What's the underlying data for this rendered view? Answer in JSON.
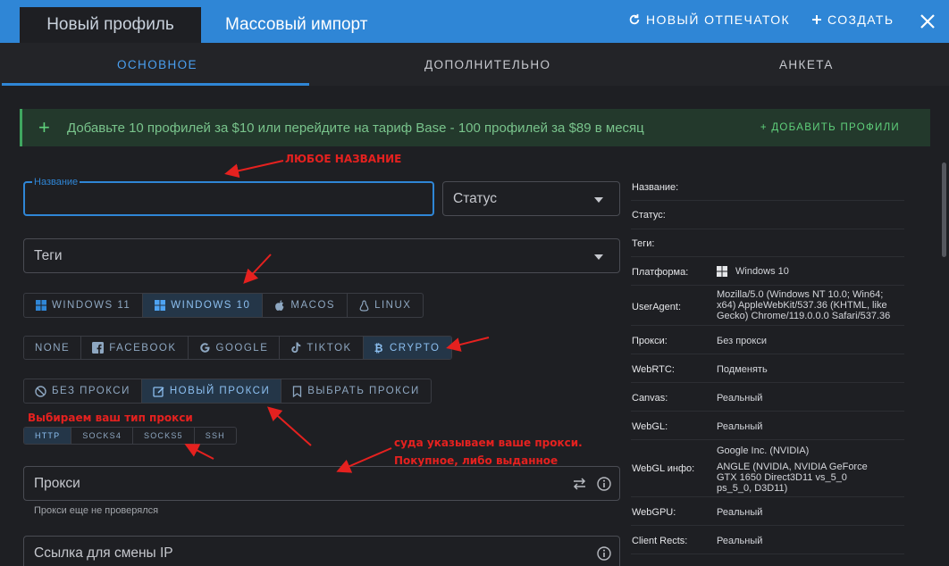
{
  "header": {
    "tab_new": "Новый профиль",
    "tab_import": "Массовый импорт",
    "fingerprint_label": "НОВЫЙ ОТПЕЧАТОК",
    "create_label": "СОЗДАТЬ"
  },
  "subtabs": [
    "ОСНОВНОЕ",
    "ДОПОЛНИТЕЛЬНО",
    "АНКЕТА"
  ],
  "promo": {
    "text": "Добавьте 10 профилей за $10 или перейдите на тариф Base - 100 профилей за $89 в месяц",
    "action": "+ ДОБАВИТЬ ПРОФИЛИ"
  },
  "form": {
    "name_label": "Название",
    "status_placeholder": "Статус",
    "tags_placeholder": "Теги",
    "os_options": [
      "WINDOWS 11",
      "WINDOWS 10",
      "MACOS",
      "LINUX"
    ],
    "os_selected": "WINDOWS 10",
    "tag_presets": [
      "NONE",
      "FACEBOOK",
      "GOOGLE",
      "TIKTOK",
      "CRYPTO"
    ],
    "tag_selected": "CRYPTO",
    "proxy_modes": [
      "БЕЗ ПРОКСИ",
      "НОВЫЙ ПРОКСИ",
      "ВЫБРАТЬ ПРОКСИ"
    ],
    "proxy_mode_selected": "НОВЫЙ ПРОКСИ",
    "proxy_types": [
      "HTTP",
      "SOCKS4",
      "SOCKS5",
      "SSH"
    ],
    "proxy_type_selected": "HTTP",
    "proxy_placeholder": "Прокси",
    "proxy_status": "Прокси еще не проверялся",
    "ip_change_placeholder": "Ссылка для смены IP"
  },
  "info": {
    "name": "Название:",
    "status": "Статус:",
    "tags": "Теги:",
    "platform_label": "Платформа:",
    "platform_value": "Windows 10",
    "ua_label": "UserAgent:",
    "ua_line1": "Mozilla/5.0 (Windows NT 10.0; Win64;",
    "ua_line2": "x64) AppleWebKit/537.36 (KHTML, like",
    "ua_line3": "Gecko) Chrome/119.0.0.0 Safari/537.36",
    "proxy_label": "Прокси:",
    "proxy_value": "Без прокси",
    "webrtc_label": "WebRTC:",
    "webrtc_value": "Подменять",
    "canvas_label": "Canvas:",
    "canvas_value": "Реальный",
    "webgl_label": "WebGL:",
    "webgl_value": "Реальный",
    "webglinfo_label": "WebGL инфо:",
    "webglinfo_line1": "Google Inc. (NVIDIA)",
    "webglinfo_line2": "ANGLE (NVIDIA, NVIDIA GeForce",
    "webglinfo_line3": "GTX 1650 Direct3D11 vs_5_0",
    "webglinfo_line4": "ps_5_0, D3D11)",
    "webgpu_label": "WebGPU:",
    "webgpu_value": "Реальный",
    "clientrects_label": "Client Rects:",
    "clientrects_value": "Реальный"
  },
  "annotations": {
    "any_name": "ЛЮБОЕ НАЗВАНИЕ",
    "choose_type": "Выбираем ваш тип прокси",
    "enter_proxy_1": "суда указываем ваше прокси.",
    "enter_proxy_2": "Покупное, либо выданное"
  },
  "colors": {
    "accent": "#2f86d6",
    "background": "#1e1f23",
    "promo_green": "#3fa760",
    "annotation_red": "#e5211f"
  }
}
